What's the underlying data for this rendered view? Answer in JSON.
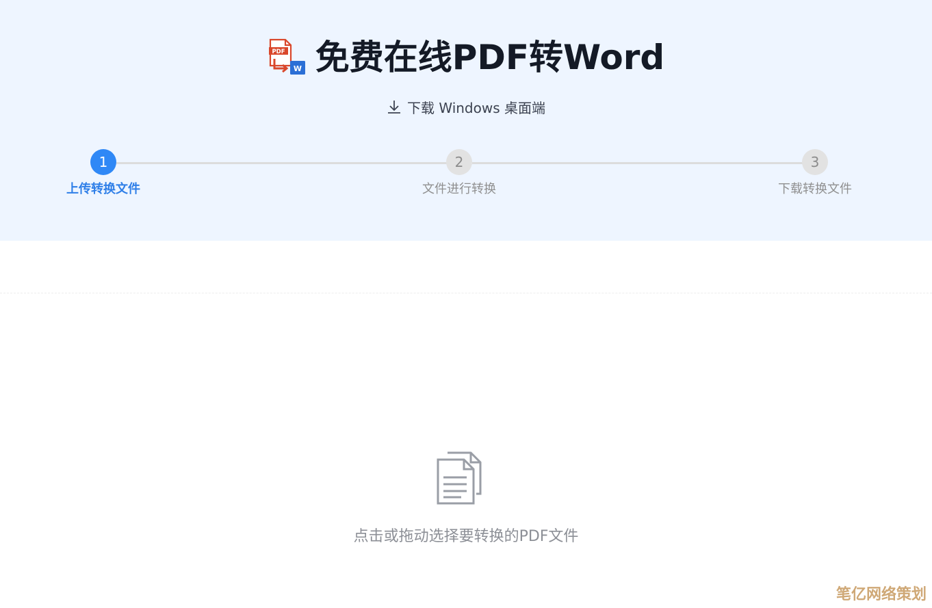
{
  "header": {
    "title": "免费在线PDF转Word",
    "logo_icon": "pdf-to-word-icon",
    "logo_pdf_text": "PDF",
    "logo_word_text": "W",
    "download_label": "下载 Windows 桌面端",
    "download_icon": "download-icon"
  },
  "steps": [
    {
      "number": "1",
      "label": "上传转换文件",
      "active": true
    },
    {
      "number": "2",
      "label": "文件进行转换",
      "active": false
    },
    {
      "number": "3",
      "label": "下载转换文件",
      "active": false
    }
  ],
  "upload": {
    "icon": "documents-icon",
    "prompt": "点击或拖动选择要转换的PDF文件"
  },
  "watermark": "笔亿网络策划",
  "colors": {
    "hero_background": "#eef5ff",
    "accent": "#2f88f6",
    "pdf_red": "#d9472b",
    "word_blue": "#2b6fd6",
    "inactive_step": "#e2e2e2",
    "muted_text": "#8c8f96"
  }
}
